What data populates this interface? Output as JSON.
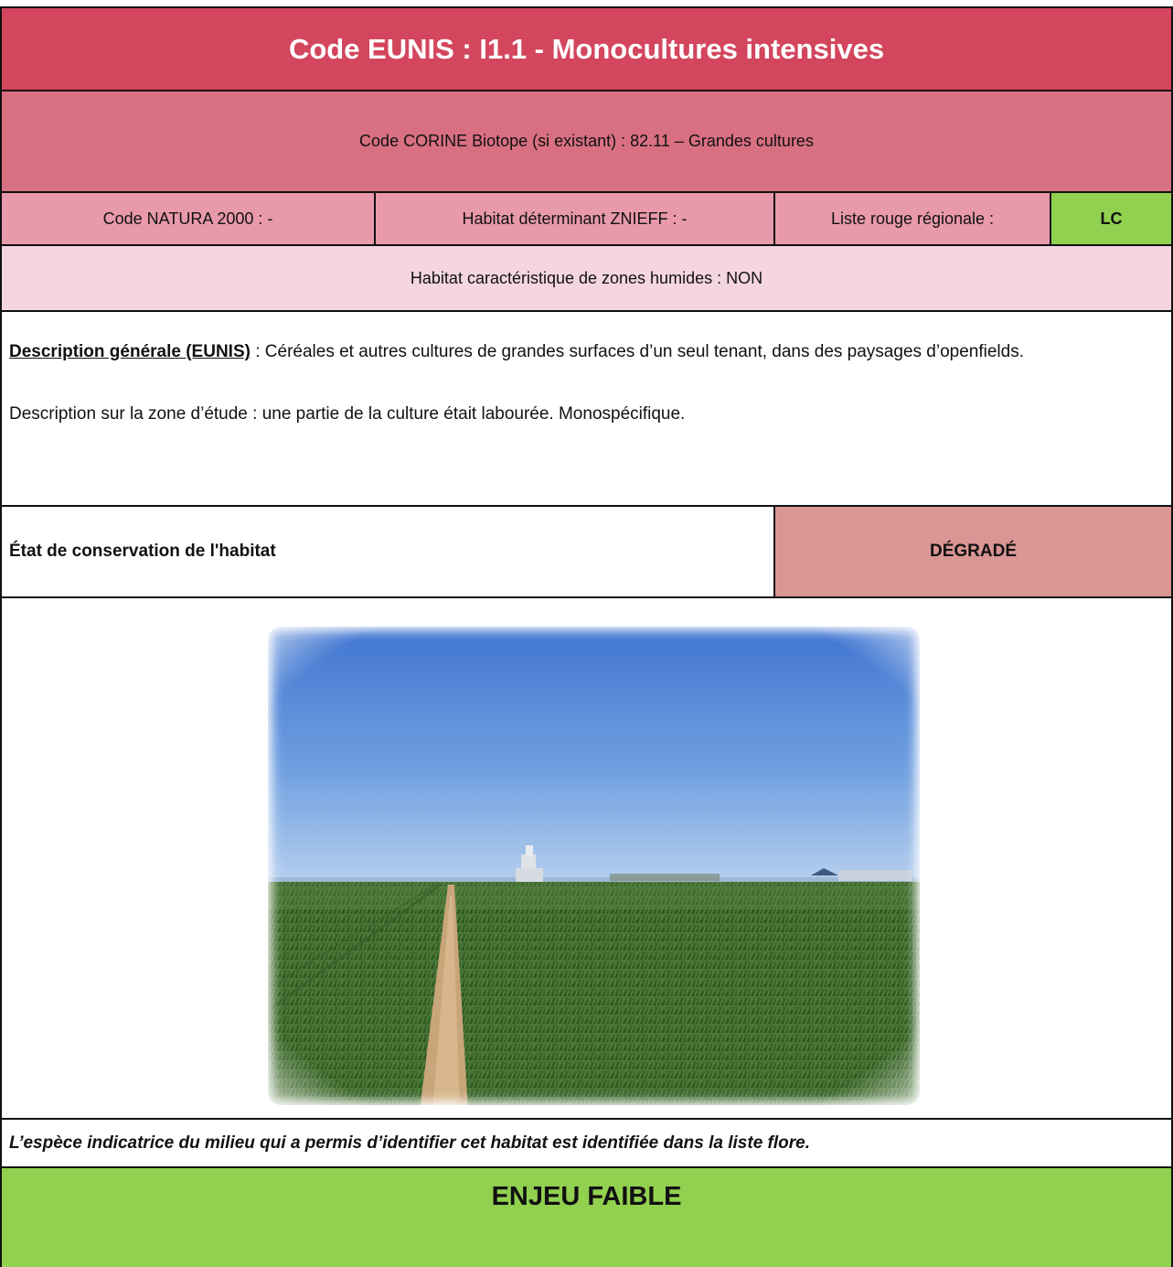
{
  "title": "Code EUNIS : I1.1 - Monocultures intensives",
  "corine": "Code CORINE Biotope (si existant) : 82.11 – Grandes cultures",
  "codes": {
    "natura": "Code NATURA 2000 : -",
    "znieff": "Habitat déterminant ZNIEFF : -",
    "liste_rouge_label": "Liste rouge régionale :",
    "liste_rouge_value": "LC"
  },
  "zones_humides": "Habitat caractéristique de zones humides : NON",
  "description": {
    "general_label": "Description générale (EUNIS)",
    "general_text": " : Céréales et autres cultures de grandes surfaces d’un seul tenant, dans des paysages d’openfields.",
    "zone_text": "Description sur la zone d’étude : une partie de la culture était labourée. Monospécifique."
  },
  "etat": {
    "label": "État de conservation de l'habitat",
    "value": "DÉGRADÉ"
  },
  "photo": {
    "subject": "wheat-field-photo"
  },
  "note": "L’espèce indicatrice du milieu qui a permis d’identifier cet habitat est identifiée dans la liste flore.",
  "enjeu": "ENJEU FAIBLE",
  "colors": {
    "title_bg": "#d3465d",
    "corine_bg": "#d87082",
    "codes_bg": "#e899aa",
    "zh_bg": "#f4d5e1",
    "lc_bg": "#92d050",
    "etat_bg": "#da9694",
    "enjeu_bg": "#92d050"
  }
}
